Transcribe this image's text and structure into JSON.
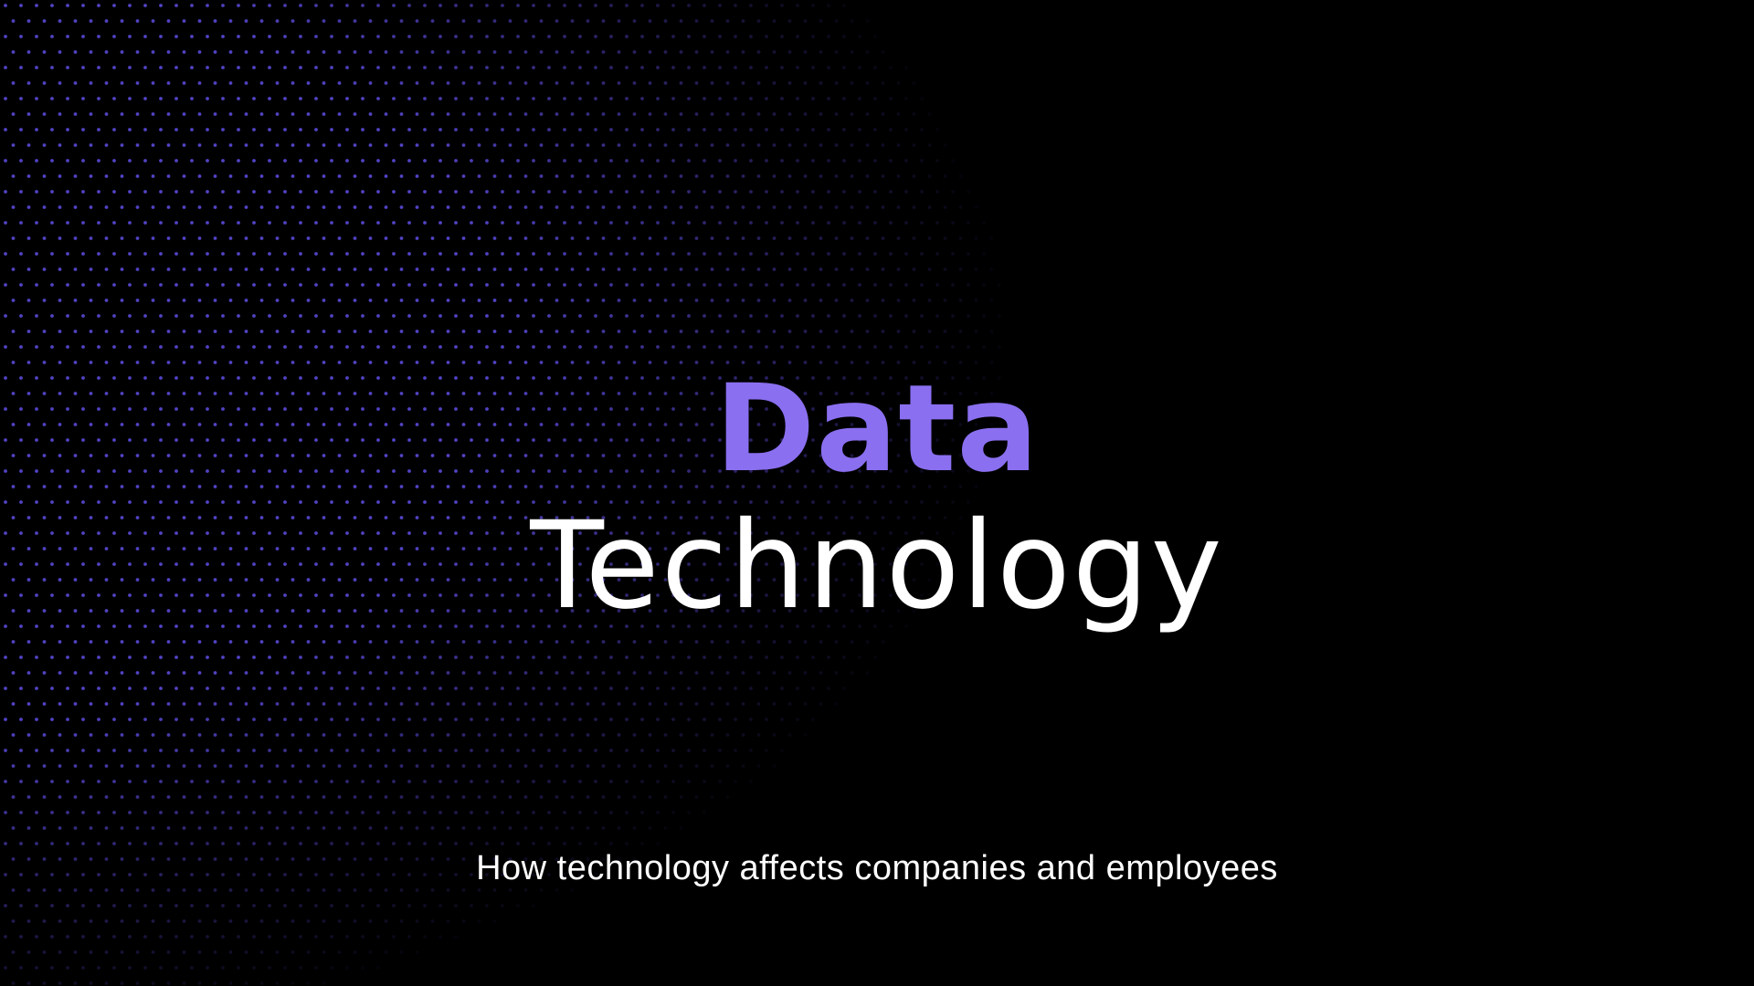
{
  "slide": {
    "title_accent": "Data",
    "title_main": "Technology",
    "subtitle": "How technology affects companies and employees"
  },
  "colors": {
    "background": "#000000",
    "accent": "#8a6ff0",
    "text": "#ffffff",
    "dots": "#5a4ad8"
  }
}
